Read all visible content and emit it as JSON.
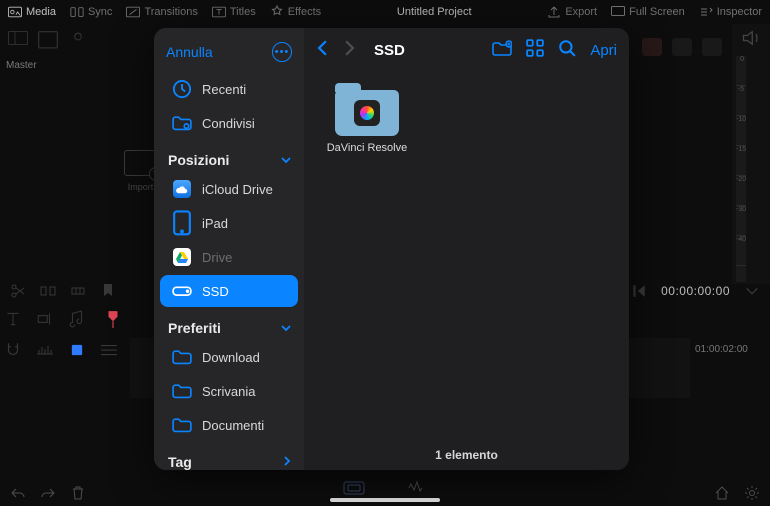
{
  "topbar": {
    "media": "Media",
    "sync": "Sync",
    "transitions": "Transitions",
    "titles": "Titles",
    "effects": "Effects",
    "project_title": "Untitled Project",
    "export": "Export",
    "fullscreen": "Full Screen",
    "inspector": "Inspector"
  },
  "background": {
    "master_label": "Master",
    "import_label": "Import",
    "timecode": "00:00:00:00",
    "track_time": "01:00:02:00",
    "ruler_ticks": [
      "0",
      "-5",
      "-10",
      "-15",
      "-20",
      "-30",
      "-40"
    ]
  },
  "picker": {
    "cancel": "Annulla",
    "recent": "Recenti",
    "shared": "Condivisi",
    "section_locations": "Posizioni",
    "icloud": "iCloud Drive",
    "ipad": "iPad",
    "drive": "Drive",
    "ssd": "SSD",
    "section_favorites": "Preferiti",
    "download": "Download",
    "desktop": "Scrivania",
    "documents": "Documenti",
    "section_tags": "Tag",
    "toolbar_location": "SSD",
    "open": "Apri",
    "folder_name": "DaVinci Resolve",
    "footer": "1 elemento"
  }
}
